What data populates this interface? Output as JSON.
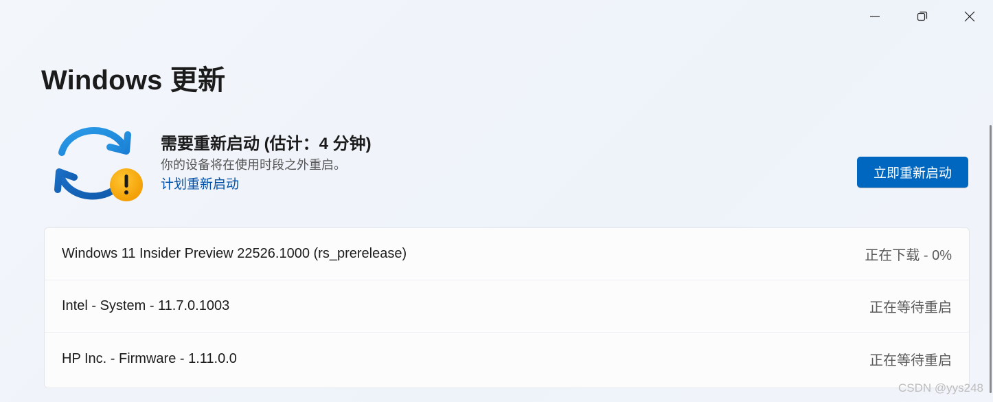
{
  "window": {
    "controls": {
      "minimize_icon": "minimize-icon",
      "restore_icon": "restore-icon",
      "close_icon": "close-icon"
    }
  },
  "header": {
    "title": "Windows 更新"
  },
  "status": {
    "icon": "sync-warning-icon",
    "title": "需要重新启动 (估计：4 分钟)",
    "subtitle": "你的设备将在使用时段之外重启。",
    "schedule_link": "计划重新启动",
    "restart_now_label": "立即重新启动"
  },
  "updates": [
    {
      "name": "Windows 11 Insider Preview 22526.1000 (rs_prerelease)",
      "status": "正在下载 - 0%"
    },
    {
      "name": "Intel - System - 11.7.0.1003",
      "status": "正在等待重启"
    },
    {
      "name": "HP Inc. - Firmware - 1.11.0.0",
      "status": "正在等待重启"
    }
  ],
  "watermark": "CSDN @yys248",
  "colors": {
    "accent": "#0067c0",
    "link": "#0050a8",
    "warning": "#f7a400"
  }
}
